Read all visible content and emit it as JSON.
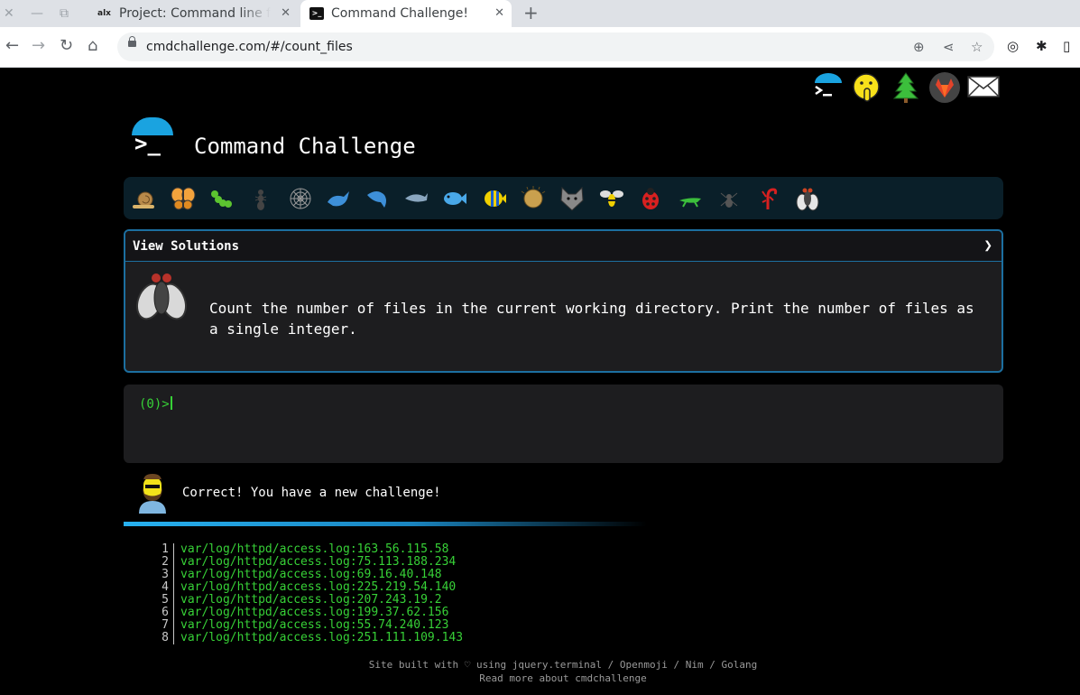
{
  "browser": {
    "window_controls": {
      "close": "✕",
      "minimize": "—",
      "restore": "⧉"
    },
    "tabs": [
      {
        "favicon_text": "alx",
        "title": "Project: Command line fo",
        "close": "✕"
      },
      {
        "favicon_text": ">_",
        "title": "Command Challenge!",
        "close": "✕"
      }
    ],
    "new_tab": "+",
    "nav": {
      "back": "←",
      "forward": "→",
      "reload": "↻",
      "home": "⌂"
    },
    "url": "cmdchallenge.com/#/count_files",
    "omnibox_icons": {
      "zoom": "⊕",
      "share": "⋖",
      "bookmark": "☆"
    },
    "toolbar_icons": {
      "profile": "◎",
      "extensions": "✱",
      "sidebar": "▯"
    }
  },
  "header": {
    "title": "Command Challenge",
    "logo_prompt": ">_",
    "top_icons": [
      "terminal-logo",
      "shushing-face",
      "christmas-tree",
      "gitlab",
      "envelope"
    ]
  },
  "challenge_icons": [
    "snail",
    "butterfly",
    "caterpillar",
    "ant",
    "spider-web",
    "whale",
    "dolphin",
    "dolphin",
    "fish",
    "tropical-fish",
    "pufferfish",
    "wolf",
    "bee",
    "ladybug",
    "cricket",
    "spider",
    "scorpion",
    "fly"
  ],
  "problem": {
    "header": "View Solutions",
    "chevron": "❯",
    "description": "Count the number of files in the current working directory. Print the number of files as a single integer."
  },
  "terminal": {
    "prompt": "(0)>"
  },
  "feedback": {
    "message": "Correct! You have a new challenge!"
  },
  "output": {
    "lines": [
      {
        "n": "1",
        "text": "var/log/httpd/access.log:163.56.115.58"
      },
      {
        "n": "2",
        "text": "var/log/httpd/access.log:75.113.188.234"
      },
      {
        "n": "3",
        "text": "var/log/httpd/access.log:69.16.40.148"
      },
      {
        "n": "4",
        "text": "var/log/httpd/access.log:225.219.54.140"
      },
      {
        "n": "5",
        "text": "var/log/httpd/access.log:207.243.19.2"
      },
      {
        "n": "6",
        "text": "var/log/httpd/access.log:199.37.62.156"
      },
      {
        "n": "7",
        "text": "var/log/httpd/access.log:55.74.240.123"
      },
      {
        "n": "8",
        "text": "var/log/httpd/access.log:251.111.109.143"
      }
    ]
  },
  "footer": {
    "line1": "Site built with ♡ using jquery.terminal / Openmoji / Nim / Golang",
    "line2": "Read more about cmdchallenge"
  }
}
